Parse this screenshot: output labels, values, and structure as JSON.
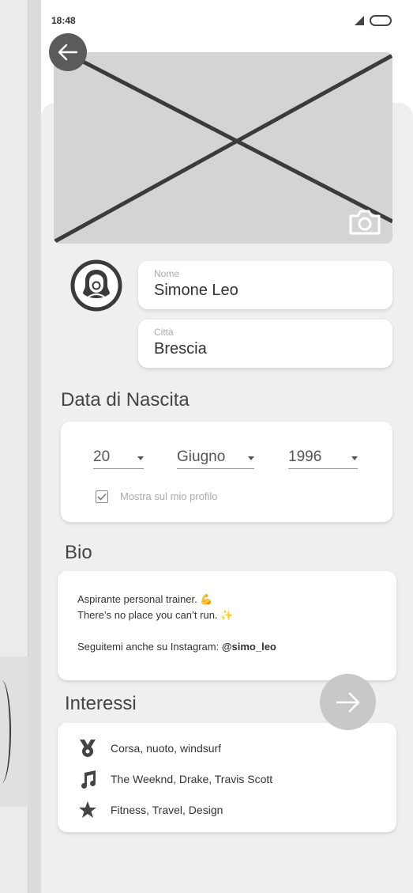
{
  "status_bar": {
    "time": "18:48"
  },
  "profile": {
    "name_label": "Nome",
    "name_value": "Simone Leo",
    "city_label": "Città",
    "city_value": "Brescia"
  },
  "birth": {
    "title": "Data di Nascita",
    "day": "20",
    "month": "Giugno",
    "year": "1996",
    "show_on_profile_label": "Mostra sul mio profilo",
    "show_on_profile_checked": true
  },
  "bio": {
    "title": "Bio",
    "line1": "Aspirante personal trainer. 💪",
    "line2": "There’s no place you can’t run. ✨",
    "line3_prefix": "Seguitemi anche su Instagram: ",
    "instagram_handle": "@simo_leo"
  },
  "interests": {
    "title": "Interessi",
    "items": [
      {
        "icon": "medal-icon",
        "text": "Corsa, nuoto, windsurf"
      },
      {
        "icon": "music-note-icon",
        "text": "The Weeknd, Drake, Travis Scott"
      },
      {
        "icon": "star-icon",
        "text": "Fitness, Travel, Design"
      }
    ]
  },
  "colors": {
    "dark_gray": "#5b5b5b",
    "fab_gray": "#c8c8c8",
    "sheet_bg": "#efefef"
  }
}
